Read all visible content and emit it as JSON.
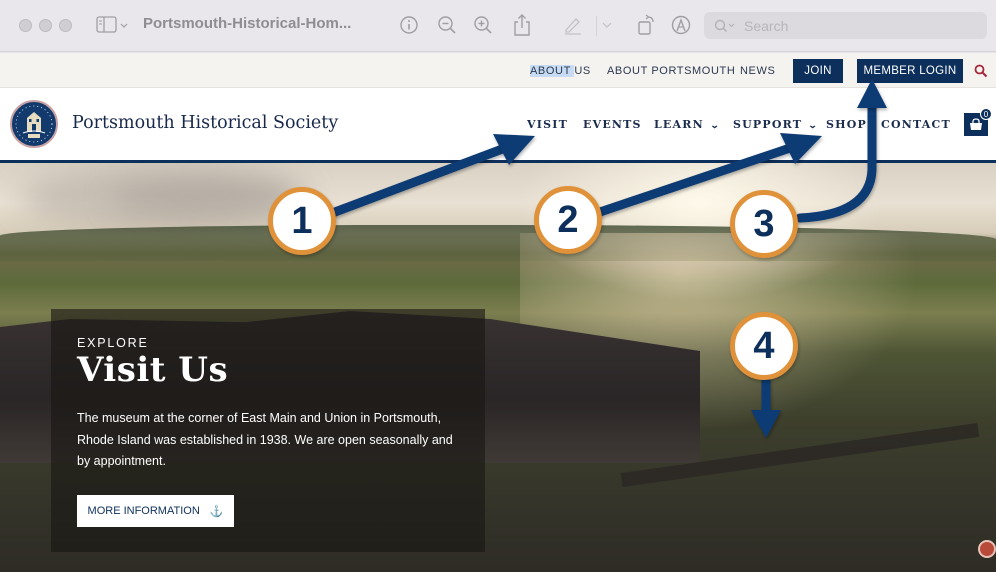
{
  "window": {
    "title": "Portsmouth-Historical-Hom...",
    "search_placeholder": "Search",
    "icons": [
      "sidebar-toggle-icon",
      "info-icon",
      "zoom-out-icon",
      "zoom-in-icon",
      "share-icon",
      "markup-pencil-icon",
      "rotate-icon",
      "annotate-icon",
      "search-icon"
    ]
  },
  "utility_nav": {
    "links": [
      {
        "label_highlighted": "ABOUT ",
        "label_rest": "US"
      },
      {
        "label": "ABOUT PORTSMOUTH"
      },
      {
        "label": "NEWS"
      }
    ],
    "join_label": "JOIN",
    "member_login_label": "MEMBER LOGIN"
  },
  "main_nav": {
    "site_name": "Portsmouth Historical Society",
    "items": [
      {
        "label": "VISIT"
      },
      {
        "label": "EVENTS"
      },
      {
        "label": "LEARN",
        "dropdown": "⌄"
      },
      {
        "label": "SUPPORT",
        "dropdown": "⌄"
      },
      {
        "label": "SHOP"
      },
      {
        "label": "CONTACT"
      }
    ],
    "cart_count": "0"
  },
  "hero": {
    "eyebrow": "EXPLORE",
    "title": "Visit Us",
    "body": "The museum at the corner of East Main and Union in Portsmouth, Rhode Island was established in 1938. We are open seasonally and by appointment.",
    "button_label": "MORE INFORMATION",
    "button_icon": "⚓"
  },
  "annotations": {
    "markers": [
      "1",
      "2",
      "3",
      "4"
    ],
    "colors": {
      "ring": "#e0923a",
      "arrow": "#0d3a73",
      "number": "#0d2f5c"
    }
  },
  "colors": {
    "brand_navy": "#0d2f5c",
    "utility_bg": "#f5f3ef",
    "highlight": "#c7dcf3",
    "search_icon_red": "#a3283a"
  }
}
